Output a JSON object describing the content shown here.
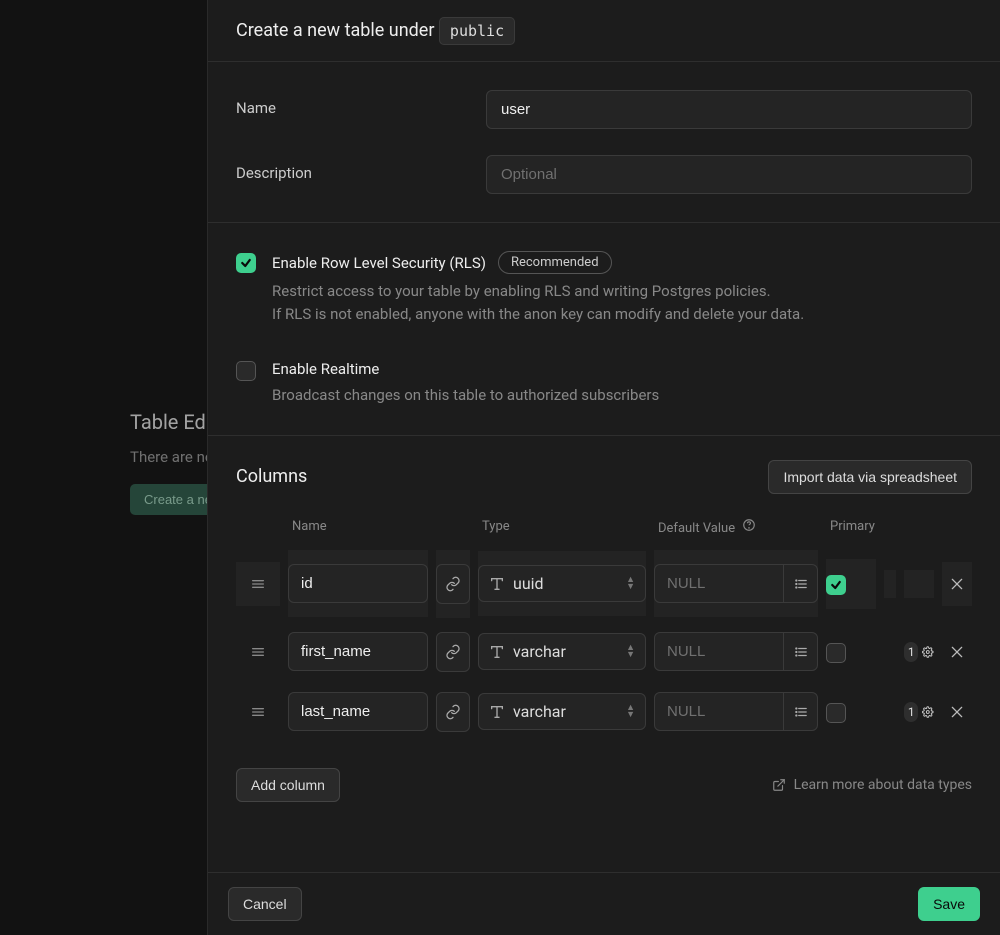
{
  "backdrop": {
    "title": "Table Editor",
    "message": "There are no tables",
    "create_btn": "Create a new table"
  },
  "header": {
    "prefix": "Create a new table under",
    "schema": "public"
  },
  "fields": {
    "name_label": "Name",
    "name_value": "user",
    "description_label": "Description",
    "description_placeholder": "Optional"
  },
  "options": {
    "rls_label": "Enable Row Level Security (RLS)",
    "rls_badge": "Recommended",
    "rls_desc_line1": "Restrict access to your table by enabling RLS and writing Postgres policies.",
    "rls_desc_line2": "If RLS is not enabled, anyone with the anon key can modify and delete your data.",
    "realtime_label": "Enable Realtime",
    "realtime_desc": "Broadcast changes on this table to authorized subscribers"
  },
  "columns_section": {
    "title": "Columns",
    "import_btn": "Import data via spreadsheet",
    "headers": {
      "name": "Name",
      "type": "Type",
      "default": "Default Value",
      "primary": "Primary"
    },
    "rows": [
      {
        "name": "id",
        "type": "uuid",
        "default_placeholder": "NULL",
        "primary": true,
        "settings_count": null,
        "highlight": true
      },
      {
        "name": "first_name",
        "type": "varchar",
        "default_placeholder": "NULL",
        "primary": false,
        "settings_count": "1",
        "highlight": false
      },
      {
        "name": "last_name",
        "type": "varchar",
        "default_placeholder": "NULL",
        "primary": false,
        "settings_count": "1",
        "highlight": false
      }
    ],
    "add_column": "Add column",
    "learn_more": "Learn more about data types"
  },
  "footer": {
    "cancel": "Cancel",
    "save": "Save"
  }
}
